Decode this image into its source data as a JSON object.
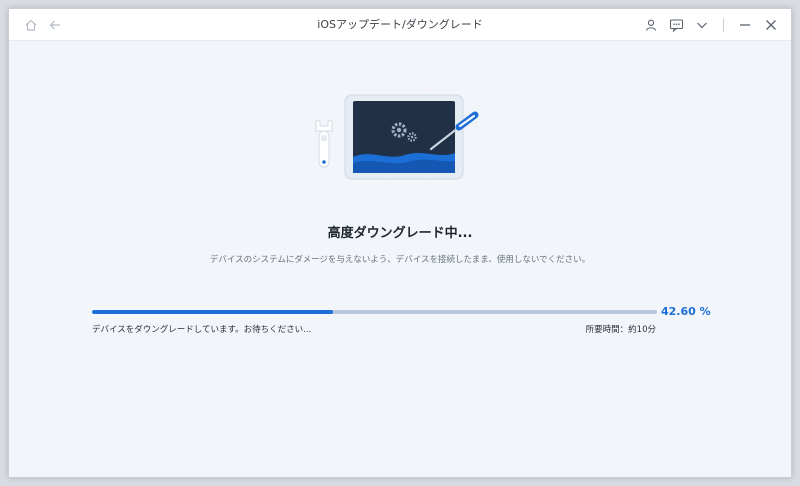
{
  "window": {
    "title": "iOSアップデート/ダウングレード"
  },
  "titlebar": {
    "left_icons": [
      "home-icon",
      "back-arrow-icon"
    ],
    "right_icons": [
      "user-icon",
      "chat-icon",
      "chevron-down-icon",
      "minimize-icon",
      "close-icon"
    ]
  },
  "main": {
    "heading": "高度ダウングレード中...",
    "subtext": "デバイスのシステムにダメージを与えないよう、デバイスを接続したまま、使用しないでください。"
  },
  "progress": {
    "value": 42.6,
    "percent_label": "42.60 %",
    "status": "デバイスをダウングレードしています。お待ちください...",
    "eta": "所要時間：約10分"
  },
  "colors": {
    "accent": "#1c6fd6",
    "track": "#b8c7de",
    "screen": "#1f3047"
  }
}
